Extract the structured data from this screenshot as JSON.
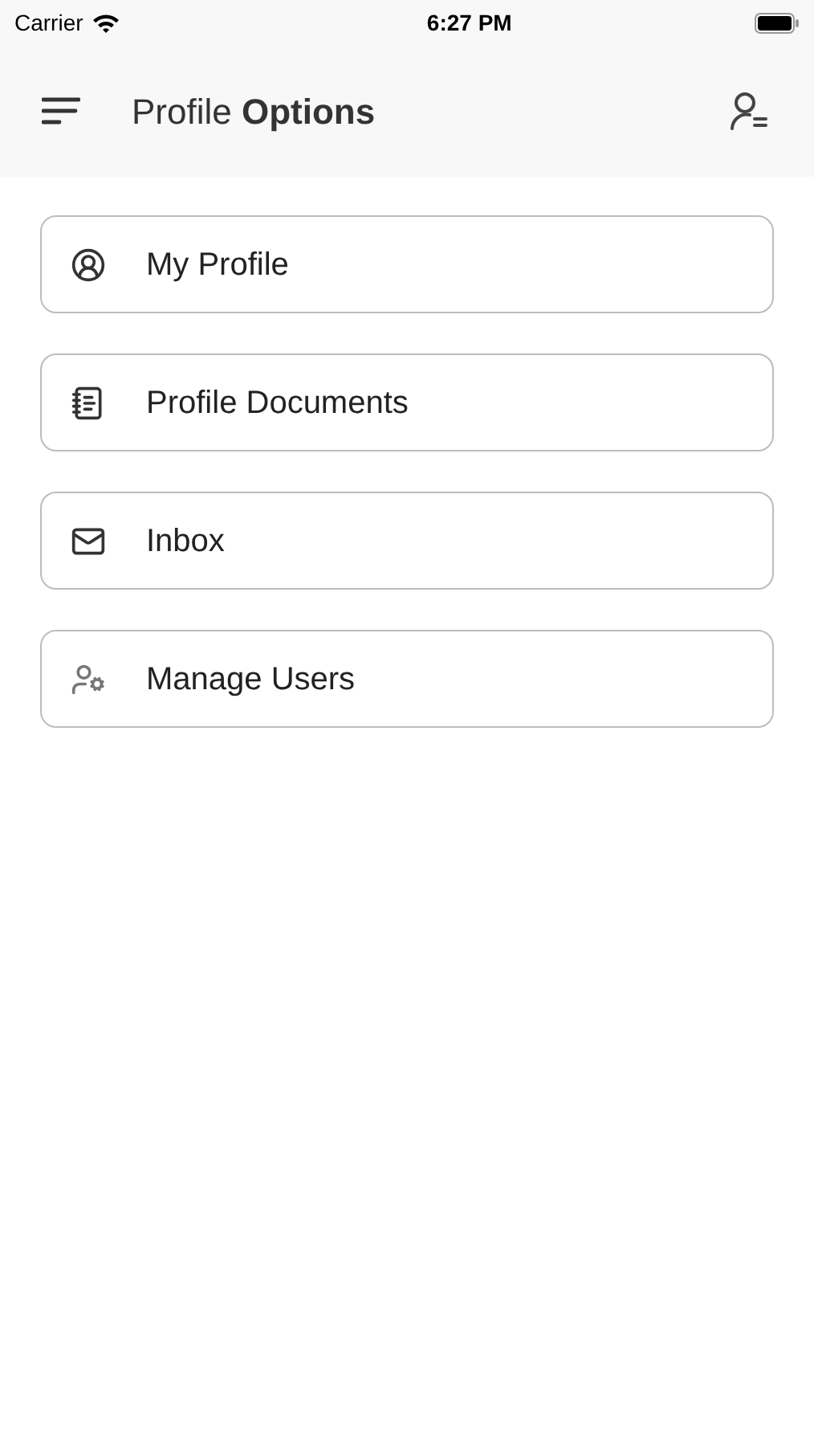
{
  "status_bar": {
    "carrier": "Carrier",
    "time": "6:27 PM"
  },
  "header": {
    "title": "Profile **Options**"
  },
  "menu": [
    {
      "kind": "profile",
      "label": "My Profile"
    },
    {
      "kind": "documents",
      "label": "Profile Documents"
    },
    {
      "kind": "inbox",
      "label": "Inbox"
    },
    {
      "kind": "users",
      "label": "Manage Users"
    }
  ]
}
